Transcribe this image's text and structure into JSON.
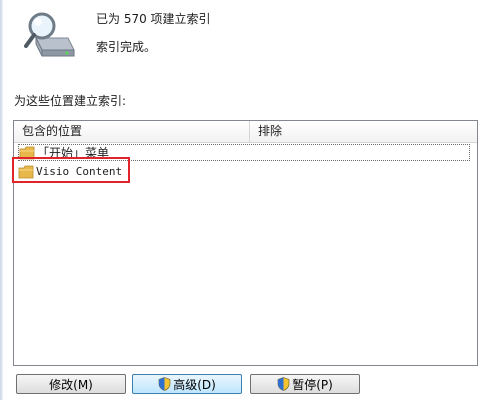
{
  "status": {
    "count_text": "已为 570 项建立索引",
    "complete_text": "索引完成。"
  },
  "locations": {
    "section_label": "为这些位置建立索引:",
    "columns": {
      "included": "包含的位置",
      "excluded": "排除"
    },
    "rows": [
      {
        "included": "「开始」菜单",
        "excluded": ""
      },
      {
        "included": "Visio Content",
        "excluded": ""
      }
    ]
  },
  "buttons": {
    "modify": "修改(M)",
    "advanced": "高级(D)",
    "pause": "暂停(P)"
  },
  "colors": {
    "highlight": "#e0242a",
    "folder": "#e8b84a"
  }
}
